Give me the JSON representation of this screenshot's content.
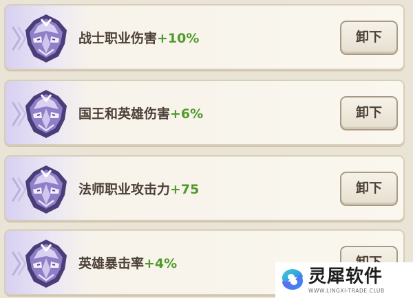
{
  "rows": [
    {
      "title": "战士职业伤害",
      "value": "+10%",
      "button": "卸下"
    },
    {
      "title": "国王和英雄伤害",
      "value": "+6%",
      "button": "卸下"
    },
    {
      "title": "法师职业攻击力",
      "value": "+75",
      "button": "卸下"
    },
    {
      "title": "英雄暴击率",
      "value": "+4%",
      "button": "卸下"
    }
  ],
  "watermark": {
    "brand": "灵犀软件",
    "url": "WWW.LINGXI-TRADE.CLUB"
  },
  "colors": {
    "value_text": "#4f9a2a",
    "label_text": "#4b3f36",
    "card_accent": "#d7d0f2",
    "background": "#e9e4d6"
  },
  "icons": {
    "row_emblem": "purple-mask-emblem-icon",
    "row_marker": "chevron-right-icon",
    "watermark_logo": "lingxi-logo-icon"
  }
}
